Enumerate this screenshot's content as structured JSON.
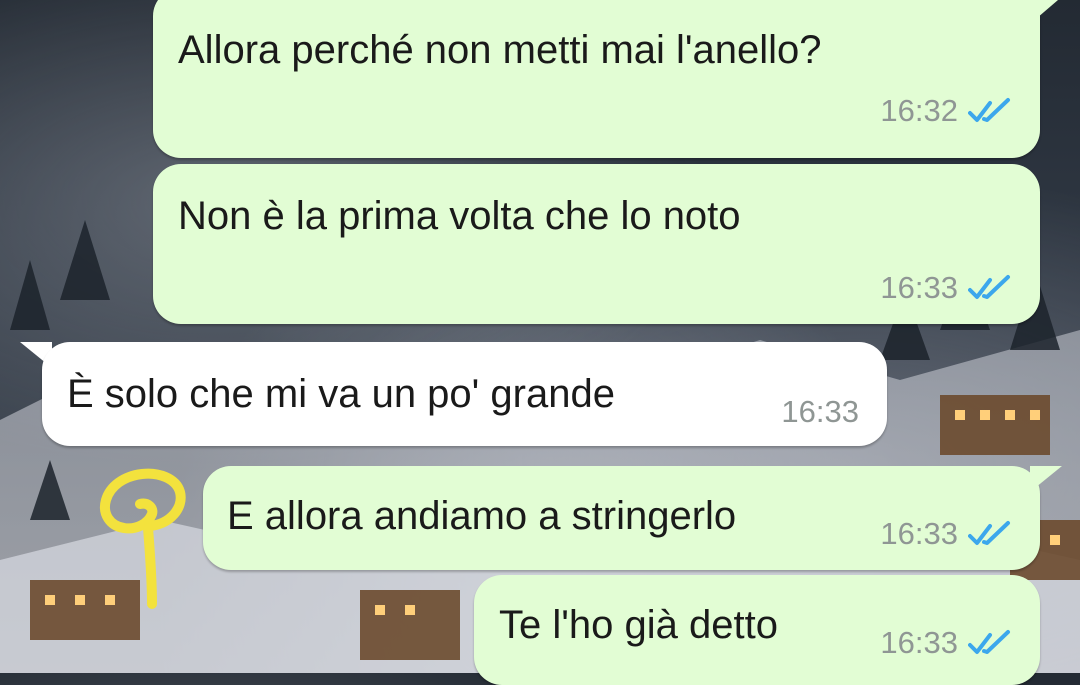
{
  "chat": {
    "messages": [
      {
        "direction": "outgoing",
        "text": "Allora perché non metti mai l'anello?",
        "time": "16:32",
        "status": "read-receipts-icon"
      },
      {
        "direction": "outgoing",
        "text": "Non è la prima volta che lo noto",
        "time": "16:33",
        "status": "read-receipts-icon"
      },
      {
        "direction": "incoming",
        "text": "È solo che mi va un po' grande",
        "time": "16:33"
      },
      {
        "direction": "outgoing",
        "text": "E allora andiamo a stringerlo",
        "time": "16:33",
        "status": "read-receipts-icon"
      },
      {
        "direction": "outgoing",
        "text": "Te l'ho già detto",
        "time": "16:33",
        "status": "read-receipts-icon"
      }
    ]
  },
  "colors": {
    "outgoing_bubble": "#e2fdd4",
    "incoming_bubble": "#ffffff",
    "read_check": "#3ca7ec",
    "annotation": "#f3e23d"
  }
}
